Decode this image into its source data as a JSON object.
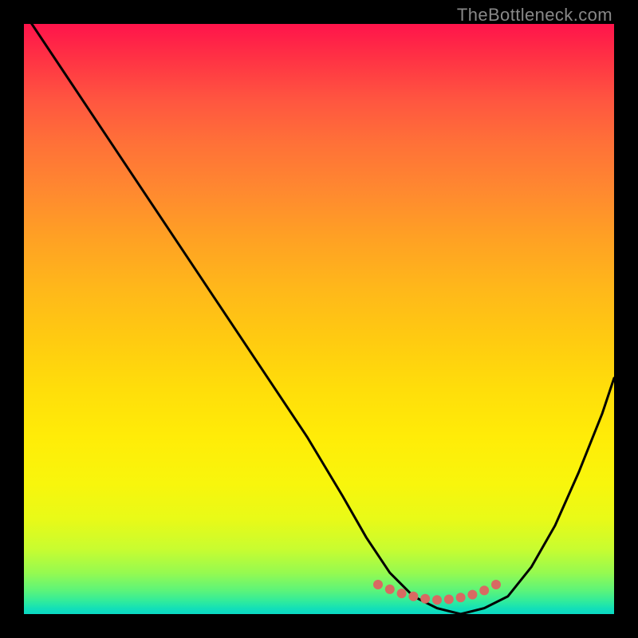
{
  "watermark": "TheBottleneck.com",
  "chart_data": {
    "type": "line",
    "title": "",
    "xlabel": "",
    "ylabel": "",
    "xlim": [
      0,
      100
    ],
    "ylim": [
      0,
      100
    ],
    "series": [
      {
        "name": "bottleneck-curve",
        "x": [
          0,
          8,
          16,
          24,
          32,
          40,
          48,
          54,
          58,
          62,
          66,
          70,
          74,
          78,
          82,
          86,
          90,
          94,
          98,
          100
        ],
        "values": [
          102,
          90,
          78,
          66,
          54,
          42,
          30,
          20,
          13,
          7,
          3,
          1,
          0,
          1,
          3,
          8,
          15,
          24,
          34,
          40
        ]
      }
    ],
    "markers": {
      "name": "recommended-range",
      "x": [
        60,
        62,
        64,
        66,
        68,
        70,
        72,
        74,
        76,
        78,
        80
      ],
      "values": [
        5,
        4.2,
        3.5,
        3.0,
        2.6,
        2.4,
        2.5,
        2.8,
        3.3,
        4.0,
        5.0
      ],
      "color": "#d86a62",
      "radius_px": 6
    },
    "background_gradient": {
      "top_color": "#ff144b",
      "bottom_color": "#0ad8c4",
      "description": "red (worst) → yellow → green (best)"
    }
  }
}
